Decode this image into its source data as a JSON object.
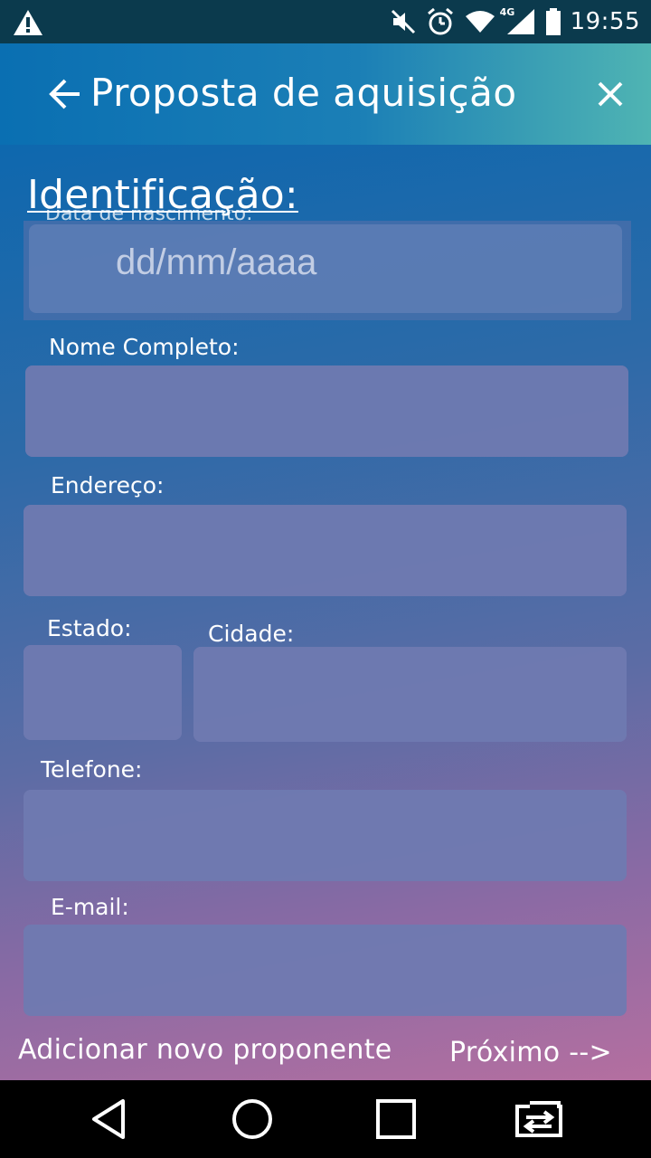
{
  "status_bar": {
    "time": "19:55",
    "network_label": "4G",
    "icons": [
      "warning-icon",
      "mute-icon",
      "alarm-icon",
      "wifi-icon",
      "signal-icon",
      "battery-icon"
    ]
  },
  "app_bar": {
    "title": "Proposta de aquisição",
    "back_icon": "arrow-left-icon",
    "close_icon": "close-icon",
    "gradient_colors": [
      "#0a6fb2",
      "#4fb4b3"
    ]
  },
  "form": {
    "section_title": "Identificação:",
    "date_of_birth": {
      "label": "Data de nascimento:",
      "placeholder": "dd/mm/aaaa"
    },
    "full_name": {
      "label": "Nome Completo:",
      "value": ""
    },
    "address": {
      "label": "Endereço:",
      "value": ""
    },
    "state": {
      "label": "Estado:",
      "value": ""
    },
    "city": {
      "label": "Cidade:",
      "value": ""
    },
    "phone": {
      "label": "Telefone:",
      "value": ""
    },
    "email": {
      "label": "E-mail:",
      "value": ""
    }
  },
  "actions": {
    "add_proponent": "Adicionar novo proponente",
    "next": "Próximo -->"
  },
  "nav_bar": {
    "icons": [
      "back-triangle-icon",
      "home-circle-icon",
      "recents-square-icon",
      "switch-app-icon"
    ]
  }
}
